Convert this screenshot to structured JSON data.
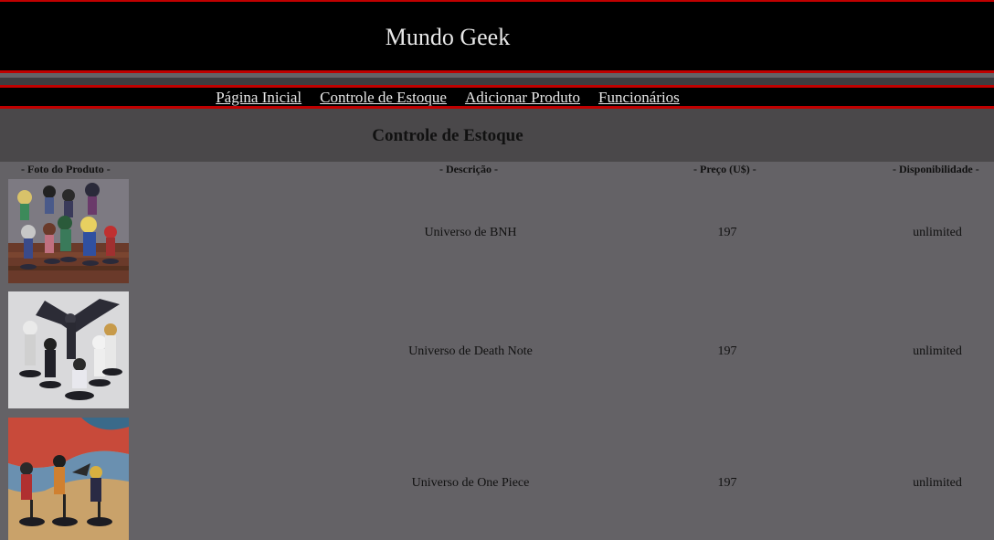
{
  "header": {
    "title": "Mundo Geek"
  },
  "nav": {
    "items": [
      {
        "label": "Página Inicial"
      },
      {
        "label": "Controle de Estoque"
      },
      {
        "label": "Adicionar Produto"
      },
      {
        "label": "Funcionários"
      }
    ]
  },
  "page": {
    "section_title": "Controle de Estoque"
  },
  "table": {
    "headers": {
      "photo": "- Foto do Produto -",
      "description": "- Descrição -",
      "price": "- Preço (U$) -",
      "availability": "- Disponibilidade -"
    },
    "rows": [
      {
        "description": "Universo de BNH",
        "price": "197",
        "availability": "unlimited"
      },
      {
        "description": "Universo de Death Note",
        "price": "197",
        "availability": "unlimited"
      },
      {
        "description": "Universo de One Piece",
        "price": "197",
        "availability": "unlimited"
      }
    ]
  }
}
